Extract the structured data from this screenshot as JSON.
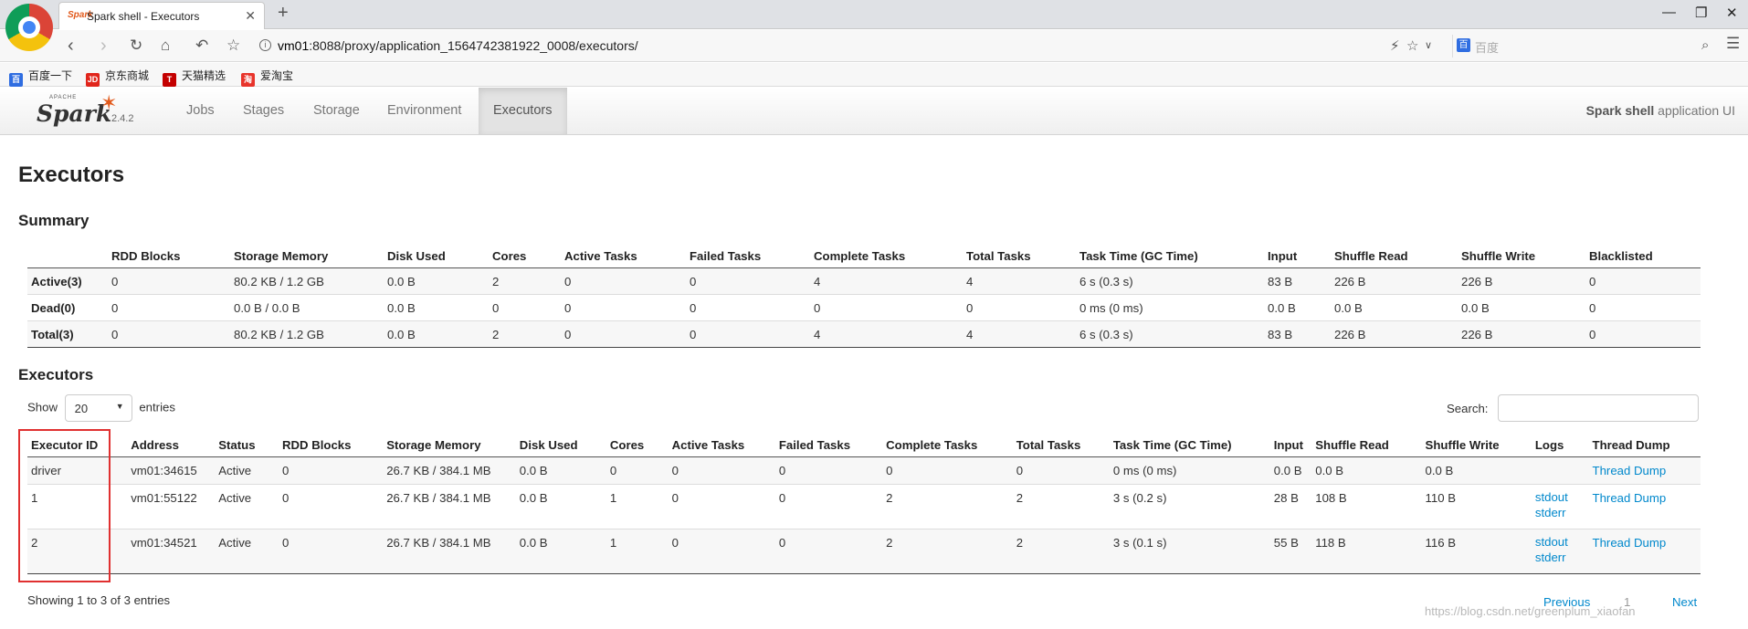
{
  "browser": {
    "tab_title": "Spark shell - Executors",
    "tab_favicon": "Spark",
    "url_host": "vm01",
    "url_rest": ":8088/proxy/application_1564742381922_0008/executors/",
    "search_engine_placeholder": "百度",
    "bookmarks": [
      "百度一下",
      "京东商城",
      "天猫精选",
      "爱淘宝"
    ],
    "bookmark_icons": [
      "baidu-paw-icon",
      "jd-icon",
      "tmall-icon",
      "taobao-icon"
    ]
  },
  "navbar": {
    "logo_small": "APACHE",
    "logo_word": "Spark",
    "version": "2.4.2",
    "tabs": [
      "Jobs",
      "Stages",
      "Storage",
      "Environment",
      "Executors"
    ],
    "active_tab": "Executors",
    "app_name_bold": "Spark shell",
    "app_name_suffix": " application UI"
  },
  "page": {
    "title": "Executors",
    "summary_heading": "Summary",
    "executors_heading": "Executors"
  },
  "summary": {
    "headers": [
      "",
      "RDD Blocks",
      "Storage Memory",
      "Disk Used",
      "Cores",
      "Active Tasks",
      "Failed Tasks",
      "Complete Tasks",
      "Total Tasks",
      "Task Time (GC Time)",
      "Input",
      "Shuffle Read",
      "Shuffle Write",
      "Blacklisted"
    ],
    "rows": [
      [
        "Active(3)",
        "0",
        "80.2 KB / 1.2 GB",
        "0.0 B",
        "2",
        "0",
        "0",
        "4",
        "4",
        "6 s (0.3 s)",
        "83 B",
        "226 B",
        "226 B",
        "0"
      ],
      [
        "Dead(0)",
        "0",
        "0.0 B / 0.0 B",
        "0.0 B",
        "0",
        "0",
        "0",
        "0",
        "0",
        "0 ms (0 ms)",
        "0.0 B",
        "0.0 B",
        "0.0 B",
        "0"
      ],
      [
        "Total(3)",
        "0",
        "80.2 KB / 1.2 GB",
        "0.0 B",
        "2",
        "0",
        "0",
        "4",
        "4",
        "6 s (0.3 s)",
        "83 B",
        "226 B",
        "226 B",
        "0"
      ]
    ]
  },
  "executors_table": {
    "show_label": "Show",
    "entries_value": "20",
    "entries_label": "entries",
    "search_label": "Search:",
    "headers": [
      "Executor ID",
      "Address",
      "Status",
      "RDD Blocks",
      "Storage Memory",
      "Disk Used",
      "Cores",
      "Active Tasks",
      "Failed Tasks",
      "Complete Tasks",
      "Total Tasks",
      "Task Time (GC Time)",
      "Input",
      "Shuffle Read",
      "Shuffle Write",
      "Logs",
      "Thread Dump"
    ],
    "rows": [
      [
        "driver",
        "vm01:34615",
        "Active",
        "0",
        "26.7 KB / 384.1 MB",
        "0.0 B",
        "0",
        "0",
        "0",
        "0",
        "0",
        "0 ms (0 ms)",
        "0.0 B",
        "0.0 B",
        "0.0 B",
        "",
        "",
        "Thread Dump"
      ],
      [
        "1",
        "vm01:55122",
        "Active",
        "0",
        "26.7 KB / 384.1 MB",
        "0.0 B",
        "1",
        "0",
        "0",
        "2",
        "2",
        "3 s (0.2 s)",
        "28 B",
        "108 B",
        "110 B",
        "stdout",
        "stderr",
        "Thread Dump"
      ],
      [
        "2",
        "vm01:34521",
        "Active",
        "0",
        "26.7 KB / 384.1 MB",
        "0.0 B",
        "1",
        "0",
        "0",
        "2",
        "2",
        "3 s (0.1 s)",
        "55 B",
        "118 B",
        "116 B",
        "stdout",
        "stderr",
        "Thread Dump"
      ]
    ],
    "showing_text": "Showing 1 to 3 of 3 entries",
    "pagination": {
      "previous": "Previous",
      "current": "1",
      "next": "Next"
    }
  },
  "watermark": "https://blog.csdn.net/greenplum_xiaofan"
}
